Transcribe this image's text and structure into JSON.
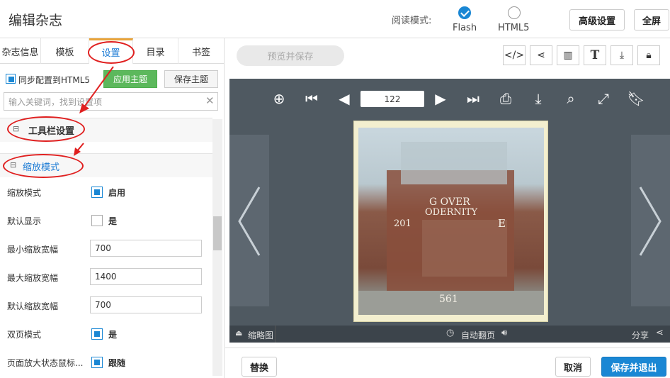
{
  "header": {
    "title": "编辑杂志",
    "mode_label": "阅读模式:",
    "modes": [
      {
        "label": "Flash",
        "selected": true
      },
      {
        "label": "HTML5",
        "selected": false
      }
    ],
    "advanced_btn": "高级设置",
    "fullscreen_btn": "全屏"
  },
  "tabs": [
    "杂志信息",
    "模板",
    "设置",
    "目录",
    "书签"
  ],
  "sync_label": "同步配置到HTML5",
  "apply_theme": "应用主题",
  "save_theme": "保存主题",
  "search_placeholder": "输入关键词，找到设置项",
  "sections": {
    "toolbar": "工具栏设置",
    "zoom": "缩放模式"
  },
  "rows": [
    {
      "label": "缩放模式",
      "type": "check",
      "checked": true,
      "value": "启用"
    },
    {
      "label": "默认显示",
      "type": "check",
      "checked": false,
      "value": "是"
    },
    {
      "label": "最小缩放宽幅",
      "type": "input",
      "value": "700"
    },
    {
      "label": "最大缩放宽幅",
      "type": "input",
      "value": "1400"
    },
    {
      "label": "默认缩放宽幅",
      "type": "input",
      "value": "700"
    },
    {
      "label": "双页模式",
      "type": "check",
      "checked": true,
      "value": "是"
    },
    {
      "label": "页面放大状态鼠标...",
      "type": "check",
      "checked": true,
      "value": "跟随"
    }
  ],
  "preview_btn": "预览并保存",
  "page_number": "122",
  "cover": {
    "text1": "G OVER",
    "text2": "ODERNITY",
    "text3": "E",
    "text4": "201",
    "page": "561"
  },
  "bottom": {
    "thumbnails": "缩略图",
    "autoflip": "自动翻页",
    "share": "分享"
  },
  "footer": {
    "replace": "替换",
    "cancel": "取消",
    "save_exit": "保存并退出"
  },
  "colors": {
    "accent": "#1a87d4",
    "green": "#5cb85c",
    "annotation": "#e02020"
  }
}
